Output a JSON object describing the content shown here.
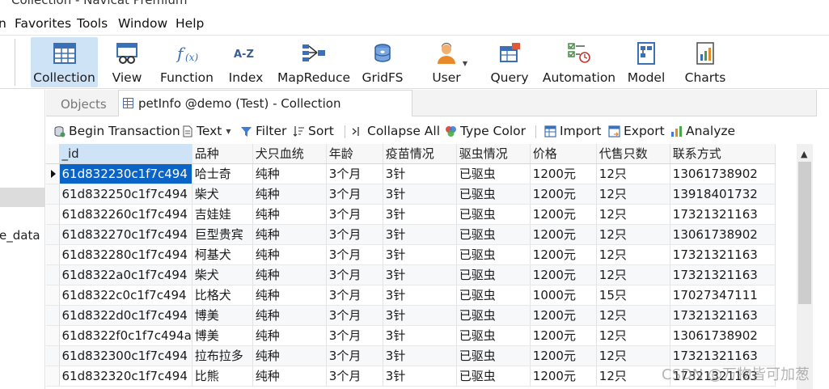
{
  "window": {
    "title": "Collection - Navicat Premium"
  },
  "menu": [
    "n",
    "Favorites",
    "Tools",
    "Window",
    "Help"
  ],
  "toolbar": {
    "items": [
      {
        "label": "Collection",
        "icon": "collection-icon",
        "active": true
      },
      {
        "label": "View",
        "icon": "view-icon"
      },
      {
        "label": "Function",
        "icon": "function-icon"
      },
      {
        "label": "Index",
        "icon": "index-icon"
      },
      {
        "label": "MapReduce",
        "icon": "mapreduce-icon"
      },
      {
        "label": "GridFS",
        "icon": "gridfs-icon"
      },
      {
        "label": "User",
        "icon": "user-icon"
      },
      {
        "label": "Query",
        "icon": "query-icon"
      },
      {
        "label": "Automation",
        "icon": "automation-icon"
      },
      {
        "label": "Model",
        "icon": "model-icon"
      },
      {
        "label": "Charts",
        "icon": "charts-icon"
      }
    ]
  },
  "sidebar": {
    "truncated_label": "e_data"
  },
  "tabs": {
    "objects": "Objects",
    "document": "petInfo @demo (Test) - Collection"
  },
  "actions": {
    "begin_transaction": "Begin Transaction",
    "text": "Text",
    "filter": "Filter",
    "sort": "Sort",
    "collapse_all": "Collapse All",
    "type_color": "Type Color",
    "import": "Import",
    "export": "Export",
    "analyze": "Analyze"
  },
  "grid": {
    "columns": [
      "_id",
      "品种",
      "犬只血统",
      "年龄",
      "疫苗情况",
      "驱虫情况",
      "价格",
      "代售只数",
      "联系方式"
    ],
    "rows": [
      [
        "61d832230c1f7c494",
        "哈士奇",
        "纯种",
        "3个月",
        "3针",
        "已驱虫",
        "1200元",
        "12只",
        "13061738902"
      ],
      [
        "61d832250c1f7c494",
        "柴犬",
        "纯种",
        "3个月",
        "3针",
        "已驱虫",
        "1200元",
        "12只",
        "13918401732"
      ],
      [
        "61d832260c1f7c494",
        "吉娃娃",
        "纯种",
        "3个月",
        "3针",
        "已驱虫",
        "1200元",
        "12只",
        "17321321163"
      ],
      [
        "61d832270c1f7c494",
        "巨型贵宾",
        "纯种",
        "3个月",
        "3针",
        "已驱虫",
        "1200元",
        "12只",
        "13061738902"
      ],
      [
        "61d832280c1f7c494",
        "柯基犬",
        "纯种",
        "3个月",
        "3针",
        "已驱虫",
        "1200元",
        "12只",
        "17321321163"
      ],
      [
        "61d8322a0c1f7c494",
        "柴犬",
        "纯种",
        "3个月",
        "3针",
        "已驱虫",
        "1200元",
        "12只",
        "17321321163"
      ],
      [
        "61d8322c0c1f7c494",
        "比格犬",
        "纯种",
        "3个月",
        "3针",
        "已驱虫",
        "1000元",
        "15只",
        "17027347111"
      ],
      [
        "61d8322d0c1f7c494",
        "博美",
        "纯种",
        "3个月",
        "3针",
        "已驱虫",
        "1200元",
        "12只",
        "17321321163"
      ],
      [
        "61d8322f0c1f7c494a",
        "博美",
        "纯种",
        "3个月",
        "3针",
        "已驱虫",
        "1200元",
        "12只",
        "13061738902"
      ],
      [
        "61d832300c1f7c494",
        "拉布拉多",
        "纯种",
        "3个月",
        "3针",
        "已驱虫",
        "1200元",
        "12只",
        "17321321163"
      ],
      [
        "61d832320c1f7c494",
        "比熊",
        "纯种",
        "3个月",
        "3针",
        "已驱虫",
        "1200元",
        "12只",
        "17321321163"
      ]
    ]
  },
  "watermark": "CSDN @万物皆可加葱",
  "colors": {
    "selection": "#0a64c8",
    "active_tool": "#cfe3f7"
  }
}
